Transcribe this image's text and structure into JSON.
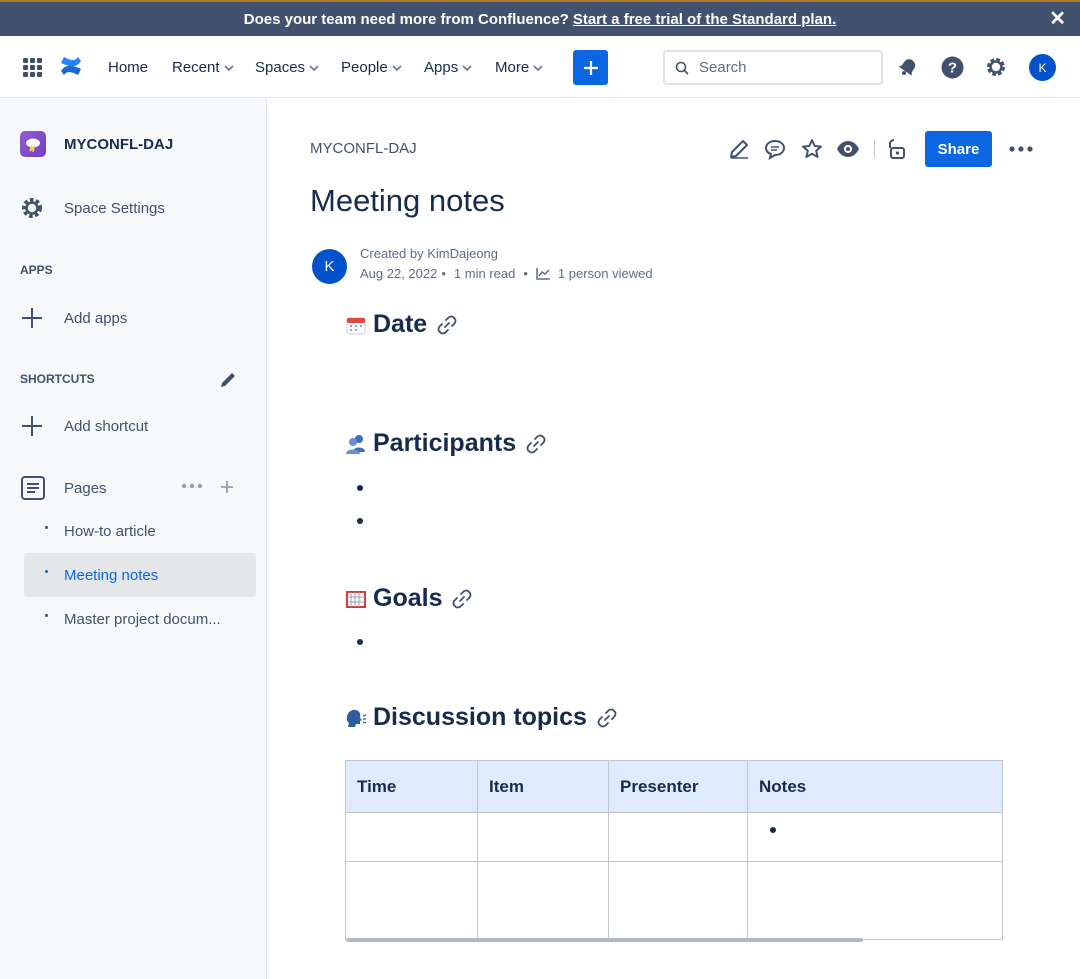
{
  "banner": {
    "text": "Does your team need more from Confluence?",
    "link": "Start a free trial of the Standard plan.",
    "close": "✕"
  },
  "nav": {
    "home": "Home",
    "recent": "Recent",
    "spaces": "Spaces",
    "people": "People",
    "apps": "Apps",
    "more": "More",
    "create": "+",
    "search_placeholder": "Search",
    "avatar": "K"
  },
  "sidebar": {
    "space_name": "MYCONFL-DAJ",
    "space_settings": "Space Settings",
    "apps_label": "APPS",
    "add_apps": "Add apps",
    "shortcuts_label": "SHORTCUTS",
    "add_shortcut": "Add shortcut",
    "pages": "Pages",
    "children": [
      {
        "label": "How-to article"
      },
      {
        "label": "Meeting notes"
      },
      {
        "label": "Master project docum..."
      }
    ]
  },
  "page": {
    "breadcrumb": "MYCONFL-DAJ",
    "share": "Share",
    "title": "Meeting notes",
    "author_initial": "K",
    "created_by": "Created by KimDajeong",
    "date": "Aug 22, 2022",
    "read_time": "1 min read",
    "views": "1 person viewed"
  },
  "sections": {
    "date": "Date",
    "participants": "Participants",
    "goals": "Goals",
    "discussion": "Discussion topics"
  },
  "table": {
    "headers": [
      "Time",
      "Item",
      "Presenter",
      "Notes"
    ]
  },
  "colors": {
    "banner_bg": "#42526e",
    "brand_blue": "#0c66e4",
    "table_header": "#dfeafe"
  }
}
